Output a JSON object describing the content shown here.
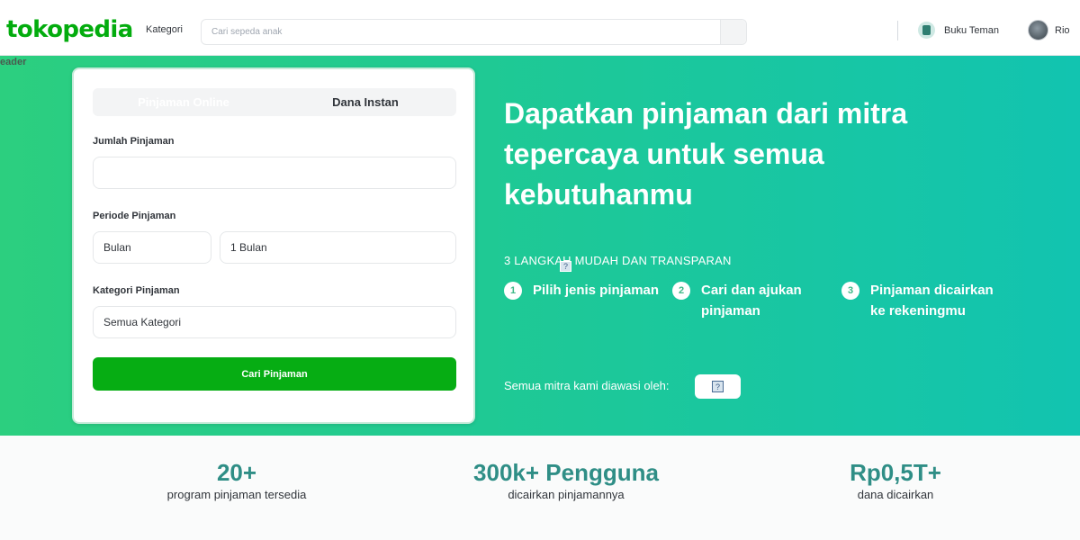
{
  "header": {
    "logo": "tokopedia",
    "category_label": "Kategori",
    "search": {
      "placeholder": "Cari sepeda anak",
      "value": ""
    },
    "buku_teman_label": "Buku Teman",
    "user_name": "Rio"
  },
  "hero": {
    "tag": "eader",
    "form": {
      "tabs": [
        {
          "label": "Pinjaman Online",
          "selected": true
        },
        {
          "label": "Dana Instan",
          "selected": false
        }
      ],
      "amount_label": "Jumlah Pinjaman",
      "amount_value": "",
      "period_label": "Periode Pinjaman",
      "period_unit": "Bulan",
      "period_value": "1 Bulan",
      "category_label": "Kategori Pinjaman",
      "category_value": "Semua Kategori",
      "submit_label": "Cari Pinjaman"
    },
    "title": "Dapatkan pinjaman dari mitra tepercaya untuk semua kebutuhanmu",
    "steps_title": "3 LANGKAH MUDAH DAN TRANSPARAN",
    "steps": [
      {
        "number": "1",
        "text": "Pilih jenis pinjaman"
      },
      {
        "number": "2",
        "text": "Cari dan ajukan pinjaman"
      },
      {
        "number": "3",
        "text": "Pinjaman dicairkan ke rekeningmu"
      }
    ],
    "supervised_label": "Semua mitra kami diawasi oleh:"
  },
  "stats": [
    {
      "value": "20+",
      "desc": "program pinjaman tersedia"
    },
    {
      "value": "300k+ Pengguna",
      "desc": "dicairkan pinjamannya"
    },
    {
      "value": "Rp0,5T+",
      "desc": "dana dicairkan"
    }
  ],
  "colors": {
    "brand_green": "#03ac0e",
    "button_green": "#06ad13",
    "hero_gradient_start": "#2ccf7f",
    "hero_gradient_end": "#12c4b0",
    "stat_teal": "#2f8e86"
  },
  "icons": {
    "search": "search-icon",
    "buku_teman": "book-icon",
    "user": "avatar",
    "broken_image": "broken-image-icon"
  }
}
